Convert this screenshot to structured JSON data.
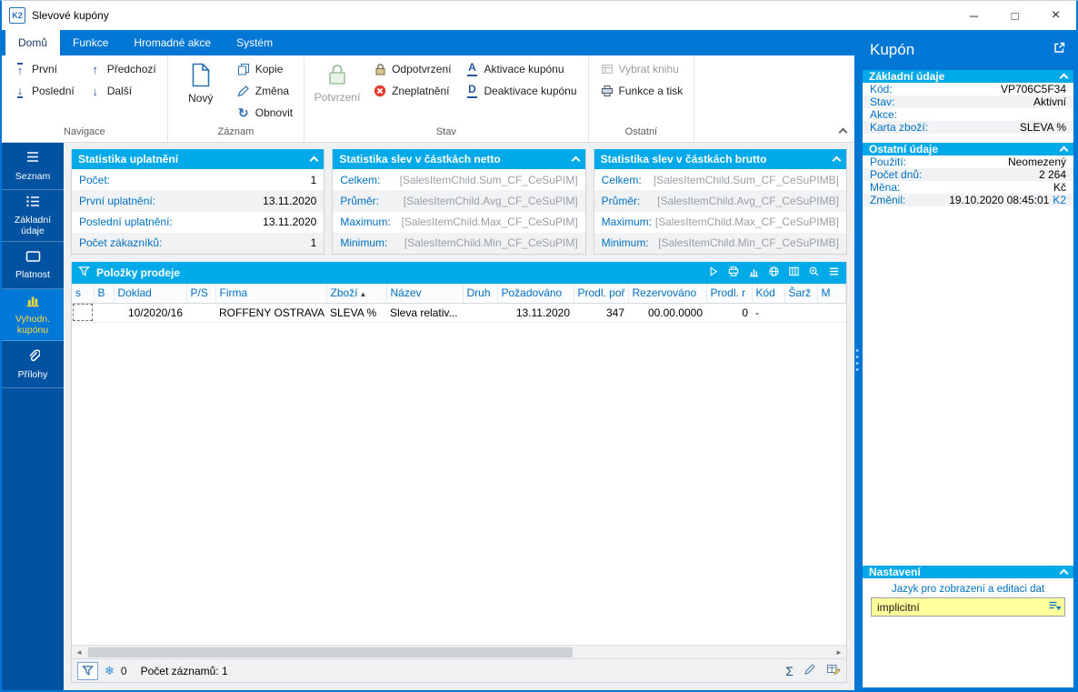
{
  "window": {
    "title": "Slevové kupóny",
    "logo": "K2"
  },
  "icons": {
    "minimize": "─",
    "maximize": "□",
    "close": "×",
    "snowflake": "❄",
    "sigma": "Σ",
    "scroll_left": "◄",
    "scroll_right": "►",
    "sort_asc": "▲",
    "refresh": "↻",
    "arrow_up": "↑",
    "arrow_down": "↓",
    "activate_glyph": "A",
    "deactivate_glyph": "D"
  },
  "ribbon": {
    "tabs": [
      {
        "label": "Domů"
      },
      {
        "label": "Funkce"
      },
      {
        "label": "Hromadné akce"
      },
      {
        "label": "Systém"
      }
    ],
    "nav": {
      "first": "První",
      "last": "Poslední",
      "prev": "Předchozí",
      "next": "Další"
    },
    "record": {
      "new": "Nový",
      "copy": "Kopie",
      "change": "Změna",
      "refresh": "Obnovit"
    },
    "state": {
      "confirm": "Potvrzení",
      "unconfirm": "Odpotvrzení",
      "invalidate": "Zneplatnění",
      "activate": "Aktivace kupónu",
      "deactivate": "Deaktivace kupónu"
    },
    "other": {
      "select_book": "Vybrat knihu",
      "functions_print": "Funkce a tisk"
    },
    "groups": {
      "nav": "Navigace",
      "record": "Záznam",
      "state": "Stav",
      "other": "Ostatní"
    }
  },
  "sidebar": {
    "items": [
      {
        "label": "Seznam"
      },
      {
        "label": "Základní údaje"
      },
      {
        "label": "Platnost"
      },
      {
        "label": "Vyhodn. kupónu"
      },
      {
        "label": "Přílohy"
      }
    ]
  },
  "stats": [
    {
      "title": "Statistika uplatnění",
      "rows": [
        {
          "label": "Počet:",
          "value": "1"
        },
        {
          "label": "První uplatnění:",
          "value": "13.11.2020"
        },
        {
          "label": "Poslední uplatnění:",
          "value": "13.11.2020"
        },
        {
          "label": "Počet zákazníků:",
          "value": "1"
        }
      ]
    },
    {
      "title": "Statistika slev v částkách netto",
      "rows": [
        {
          "label": "Celkem:",
          "value": "[SalesItemChild.Sum_CF_CeSuPIM]"
        },
        {
          "label": "Průměr:",
          "value": "[SalesItemChild.Avg_CF_CeSuPIM]"
        },
        {
          "label": "Maximum:",
          "value": "[SalesItemChild.Max_CF_CeSuPIM]"
        },
        {
          "label": "Minimum:",
          "value": "[SalesItemChild.Min_CF_CeSuPIM]"
        }
      ]
    },
    {
      "title": "Statistika slev v částkách brutto",
      "rows": [
        {
          "label": "Celkem:",
          "value": "[SalesItemChild.Sum_CF_CeSuPIMB]"
        },
        {
          "label": "Průměr:",
          "value": "[SalesItemChild.Avg_CF_CeSuPIMB]"
        },
        {
          "label": "Maximum:",
          "value": "[SalesItemChild.Max_CF_CeSuPIMB]"
        },
        {
          "label": "Minimum:",
          "value": "[SalesItemChild.Min_CF_CeSuPIMB]"
        }
      ]
    }
  ],
  "grid": {
    "title": "Položky prodeje",
    "columns": [
      "s",
      "B",
      "Doklad",
      "P/S",
      "Firma",
      "Zboží",
      "Název",
      "Druh",
      "Požadováno",
      "Prodl. poř",
      "Rezervováno",
      "Prodl. r",
      "Kód",
      "Šarž",
      "M"
    ],
    "sort_column": "Zboží",
    "rows": [
      [
        "",
        "",
        "10/2020/16",
        "",
        "ROFFENY OSTRAVA",
        "SLEVA %",
        "Sleva relativ...",
        "",
        "13.11.2020",
        "347",
        "00.00.0000",
        "0",
        "-",
        "",
        ""
      ]
    ],
    "status": {
      "filter_count": "0",
      "records": "Počet záznamů: 1"
    }
  },
  "detail": {
    "title": "Kupón",
    "sections": [
      {
        "title": "Základní údaje",
        "rows": [
          {
            "label": "Kód:",
            "value": "VP706C5F34"
          },
          {
            "label": "Stav:",
            "value": "Aktivní"
          },
          {
            "label": "Akce:",
            "value": ""
          },
          {
            "label": "Karta zboží:",
            "value": "SLEVA %"
          }
        ]
      },
      {
        "title": "Ostatní údaje",
        "rows": [
          {
            "label": "Použití:",
            "value": "Neomezený"
          },
          {
            "label": "Počet dnů:",
            "value": "2 264"
          },
          {
            "label": "Měna:",
            "value": "Kč"
          },
          {
            "label": "Změnil:",
            "value": "19.10.2020 08:45:01",
            "user": "K2"
          }
        ]
      }
    ],
    "settings": {
      "title": "Nastavení",
      "language_label": "Jazyk pro zobrazení a editaci dat",
      "language_value": "implicitní"
    }
  }
}
